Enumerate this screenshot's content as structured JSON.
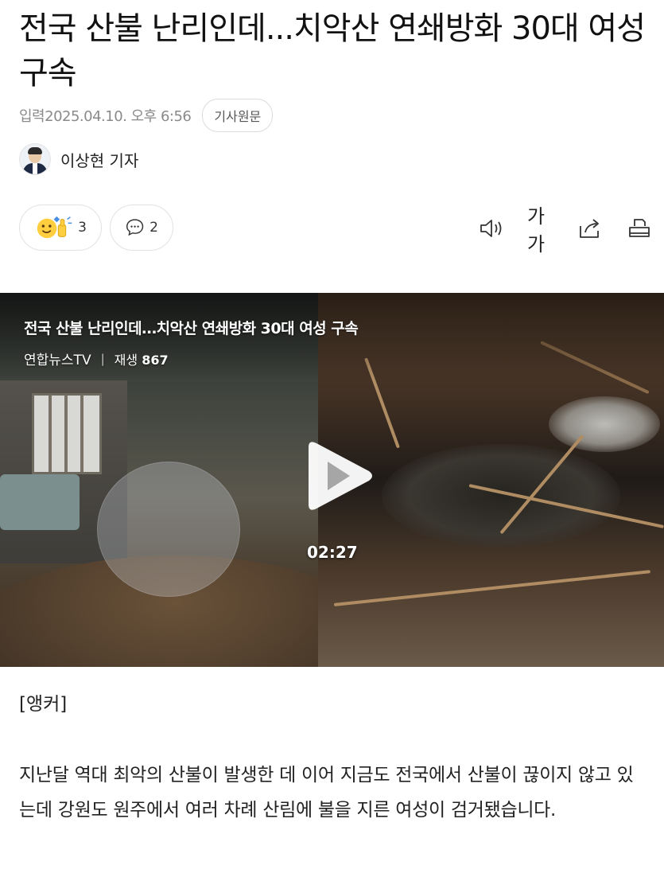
{
  "article": {
    "title": "전국 산불 난리인데...치악산 연쇄방화 30대 여성 구속",
    "date": "입력2025.04.10. 오후 6:56",
    "original_button": "기사원문",
    "reporter": "이상현 기자"
  },
  "actions": {
    "reaction_count": "3",
    "comment_count": "2",
    "font_label": "가가"
  },
  "video": {
    "title": "전국 산불 난리인데…치악산 연쇄방화 30대 여성 구속",
    "channel": "연합뉴스TV",
    "separator": "|",
    "views_label": "재생",
    "views_count": "867",
    "duration": "02:27"
  },
  "content": {
    "anchor_label": "[앵커]",
    "paragraph": "지난달 역대 최악의 산불이 발생한 데 이어 지금도 전국에서 산불이 끊이지 않고 있는데 강원도 원주에서 여러 차례 산림에 불을 지른 여성이 검거됐습니다."
  },
  "icons": {
    "reaction": "thumbs-up-emoji-icon",
    "comment": "speech-bubble-icon",
    "audio": "speaker-icon",
    "share": "share-icon",
    "print": "print-icon",
    "play": "play-icon"
  }
}
